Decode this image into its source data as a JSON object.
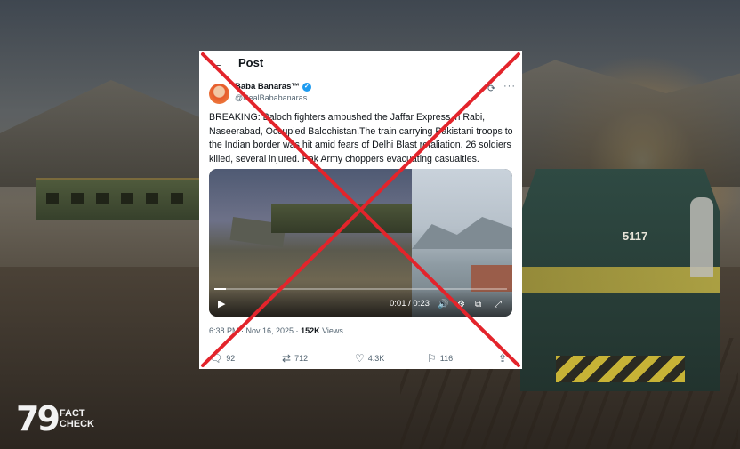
{
  "post": {
    "title": "Post",
    "author_name": "Baba Banaras™",
    "handle": "@RealBababanaras",
    "text": "BREAKING: Baloch fighters ambushed the Jaffar Express in Rabi, Naseerabad, Occupied Balochistan.The train carrying Pakistani troops to the Indian border was hit amid fears of Delhi Blast retaliation. 26 soldiers killed, several injured. Pak Army choppers evacuating casualties.",
    "video": {
      "time": "0:01 / 0:23",
      "progress": 0.04
    },
    "timestamp": "6:38 PM · Nov 16, 2025 · ",
    "views_count": "152K",
    "views_label": " Views",
    "stats": {
      "replies": "92",
      "reposts": "712",
      "likes": "4.3K",
      "bookmarks": "116"
    }
  },
  "background": {
    "locomotive_number": "5117"
  },
  "logo": {
    "mark": "79",
    "line1": "FACT",
    "line2": "CHECK"
  },
  "colors": {
    "cross": "#e3242b",
    "verified": "#1d9bf0"
  }
}
